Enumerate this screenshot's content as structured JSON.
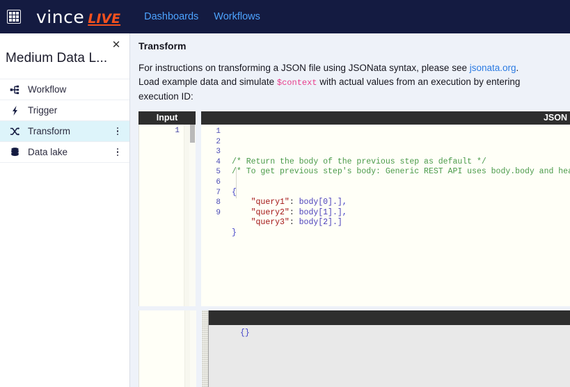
{
  "topnav": {
    "app_icon": "grid-apps-icon",
    "brand_primary": "vince",
    "brand_secondary": "LIVE",
    "links": [
      {
        "label": "Dashboards"
      },
      {
        "label": "Workflows"
      }
    ],
    "background": "#141B41",
    "link_color": "#4da3ff",
    "accent_color": "#F4511E"
  },
  "sidebar": {
    "close_label": "✕",
    "title": "Medium Data L...",
    "items": [
      {
        "label": "Workflow",
        "icon": "sitemap-icon",
        "active": false,
        "has_menu": false
      },
      {
        "label": "Trigger",
        "icon": "bolt-icon",
        "active": false,
        "has_menu": false
      },
      {
        "label": "Transform",
        "icon": "shuffle-icon",
        "active": true,
        "has_menu": true
      },
      {
        "label": "Data lake",
        "icon": "database-icon",
        "active": false,
        "has_menu": true
      }
    ],
    "active_background": "#ddf4fa"
  },
  "main": {
    "title": "Transform",
    "intro_prefix": "For instructions on transforming a JSON file using JSONata syntax, please see ",
    "intro_link": "jsonata.org",
    "intro_suffix": ".",
    "load_prefix": "Load example data and simulate ",
    "load_code": "$context",
    "load_suffix": " with actual values from an execution by entering execution ID:"
  },
  "input_editor": {
    "header": "Input",
    "line_numbers": [
      "1"
    ]
  },
  "code_editor": {
    "header": "JSON",
    "line_numbers": [
      "1",
      "2",
      "3",
      "4",
      "5",
      "6",
      "7",
      "8",
      "9"
    ],
    "lines": [
      {
        "n": "1",
        "segments": [
          {
            "text": "/* Return the body of the previous step as default */",
            "type": "comment"
          }
        ]
      },
      {
        "n": "2",
        "segments": [
          {
            "text": "/* To get previous step's body: Generic REST API uses body.body and header, other",
            "type": "comment"
          }
        ]
      },
      {
        "n": "3",
        "segments": [
          {
            "text": "",
            "type": "plain"
          }
        ]
      },
      {
        "n": "4",
        "segments": [
          {
            "text": "{",
            "type": "punct"
          }
        ]
      },
      {
        "n": "5",
        "segments": [
          {
            "text": "    ",
            "type": "plain"
          },
          {
            "text": "\"query1\"",
            "type": "key"
          },
          {
            "text": ": ",
            "type": "plain"
          },
          {
            "text": "body[0].]",
            "type": "var"
          },
          {
            "text": ",",
            "type": "punct"
          }
        ]
      },
      {
        "n": "6",
        "segments": [
          {
            "text": "    ",
            "type": "plain"
          },
          {
            "text": "\"query2\"",
            "type": "key"
          },
          {
            "text": ": ",
            "type": "plain"
          },
          {
            "text": "body[1].]",
            "type": "var"
          },
          {
            "text": ",",
            "type": "punct"
          }
        ]
      },
      {
        "n": "7",
        "segments": [
          {
            "text": "    ",
            "type": "plain"
          },
          {
            "text": "\"query3\"",
            "type": "key"
          },
          {
            "text": ": ",
            "type": "plain"
          },
          {
            "text": "body[2].]",
            "type": "var"
          }
        ]
      },
      {
        "n": "8",
        "segments": [
          {
            "text": "}",
            "type": "punct"
          }
        ]
      },
      {
        "n": "9",
        "segments": [
          {
            "text": "",
            "type": "plain"
          }
        ]
      }
    ]
  },
  "output_panel": {
    "content": "{}"
  }
}
